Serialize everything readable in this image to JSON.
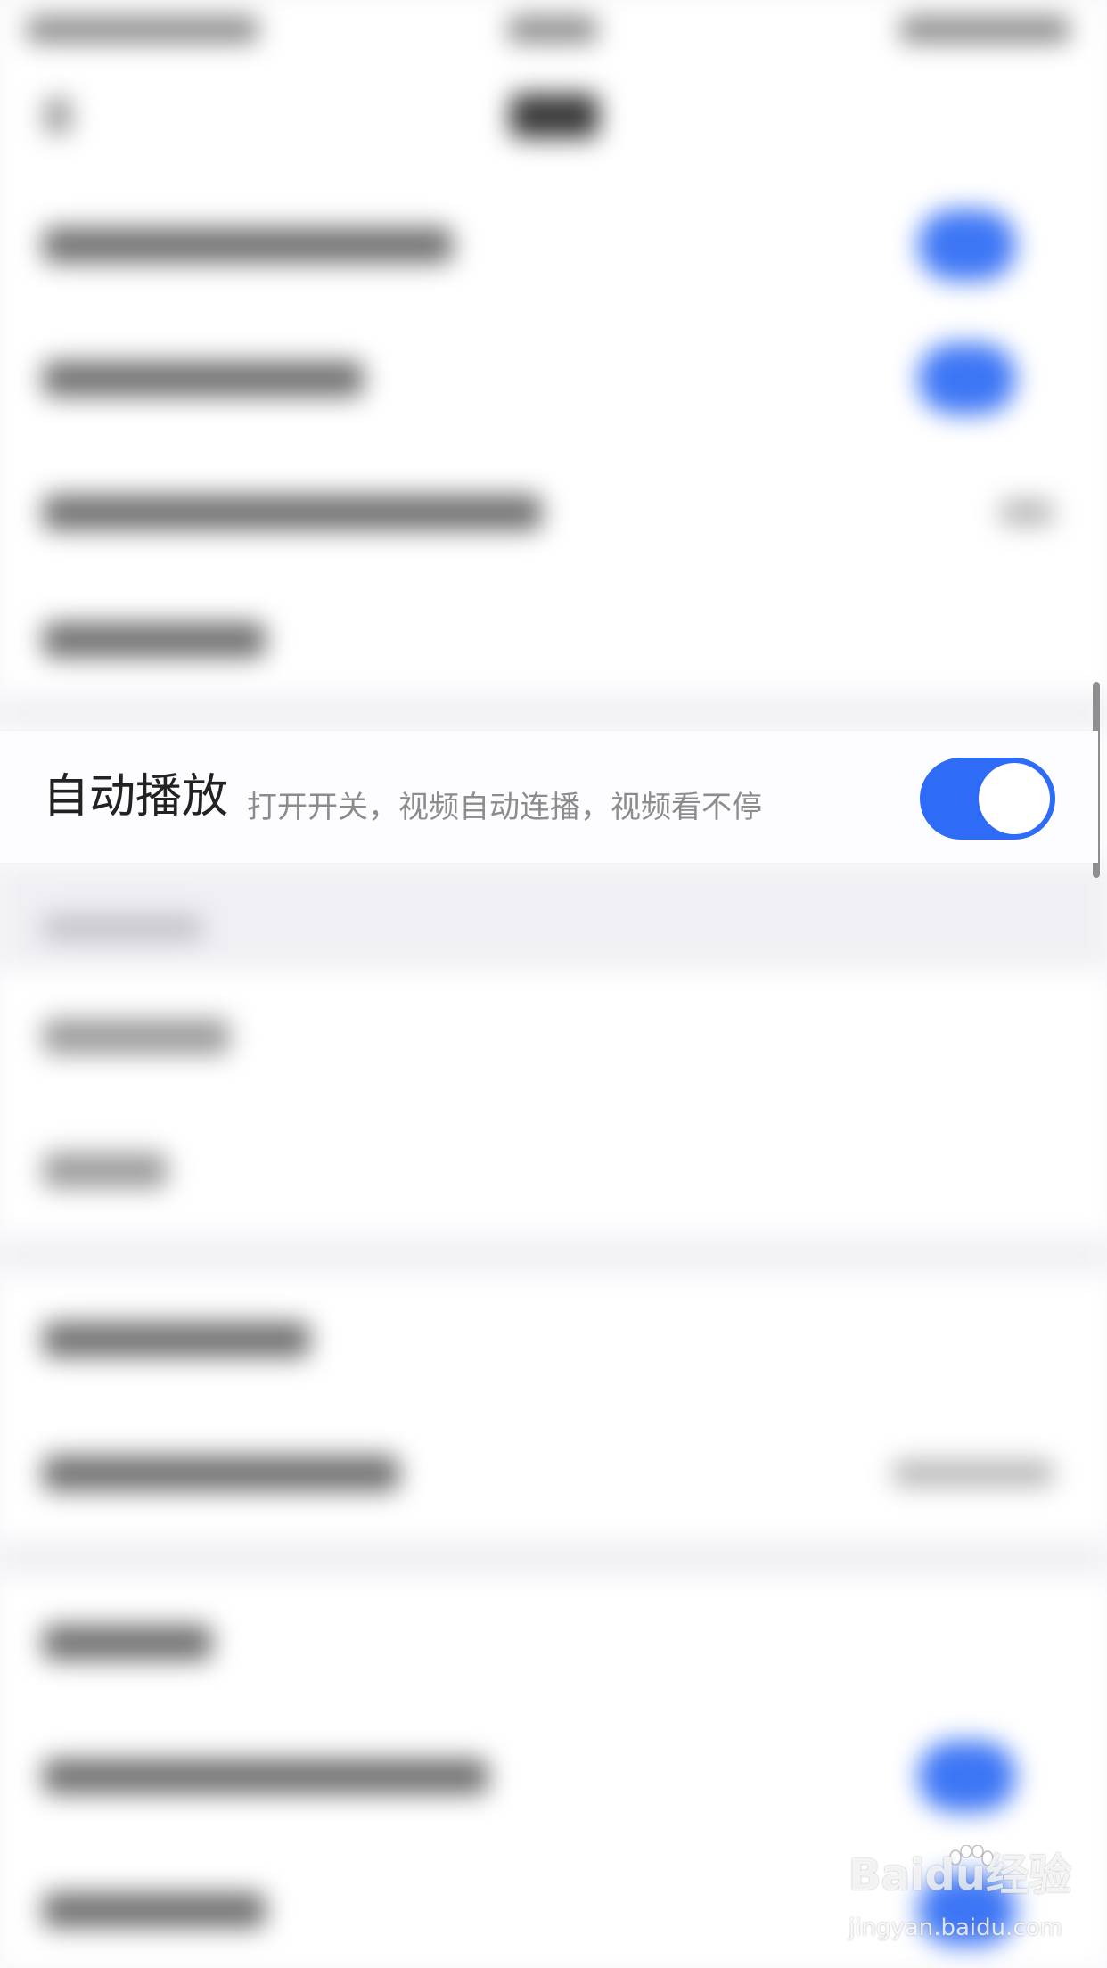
{
  "autoplay_setting": {
    "title": "自动播放",
    "description": "打开开关，视频自动连播，视频看不停",
    "enabled": true,
    "toggle_color": "#2e6bf6"
  },
  "watermark": {
    "logo_text": "Baidu经验",
    "url": "jingyan.baidu.com"
  },
  "colors": {
    "accent": "#2e6bf6",
    "page_background": "#f7f7fa"
  }
}
